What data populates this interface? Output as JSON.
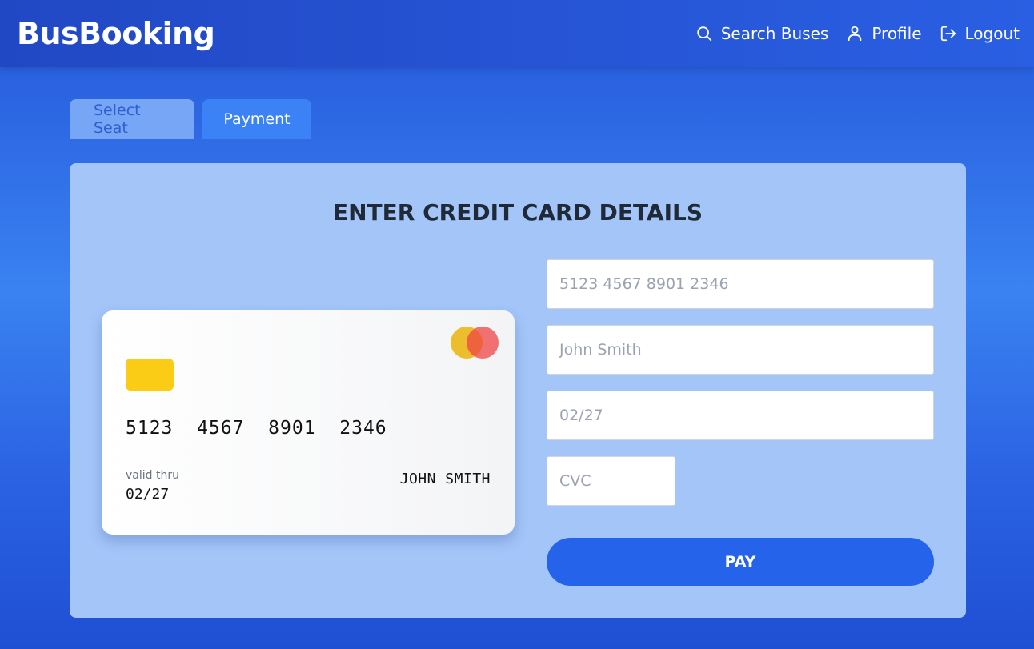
{
  "navbar": {
    "brand": "BusBooking",
    "links": [
      {
        "label": "Search Buses",
        "icon": "search-icon"
      },
      {
        "label": "Profile",
        "icon": "user-icon"
      },
      {
        "label": "Logout",
        "icon": "logout-icon"
      }
    ]
  },
  "tabs": [
    {
      "label": "Select Seat",
      "active": false
    },
    {
      "label": "Payment",
      "active": true
    }
  ],
  "payment": {
    "title": "ENTER CREDIT CARD DETAILS",
    "card": {
      "number": "5123  4567  8901  2346",
      "valid_label": "valid thru",
      "expiry": "02/27",
      "holder": "JOHN SMITH"
    },
    "fields": {
      "number_placeholder": "5123 4567 8901 2346",
      "name_placeholder": "John Smith",
      "expiry_placeholder": "02/27",
      "cvc_placeholder": "CVC"
    },
    "pay_label": "PAY"
  },
  "colors": {
    "accent": "#2563eb",
    "panel": "#a3c5f8",
    "chip": "#facc15",
    "logo_left": "#eab308",
    "logo_right": "#ef4444"
  }
}
